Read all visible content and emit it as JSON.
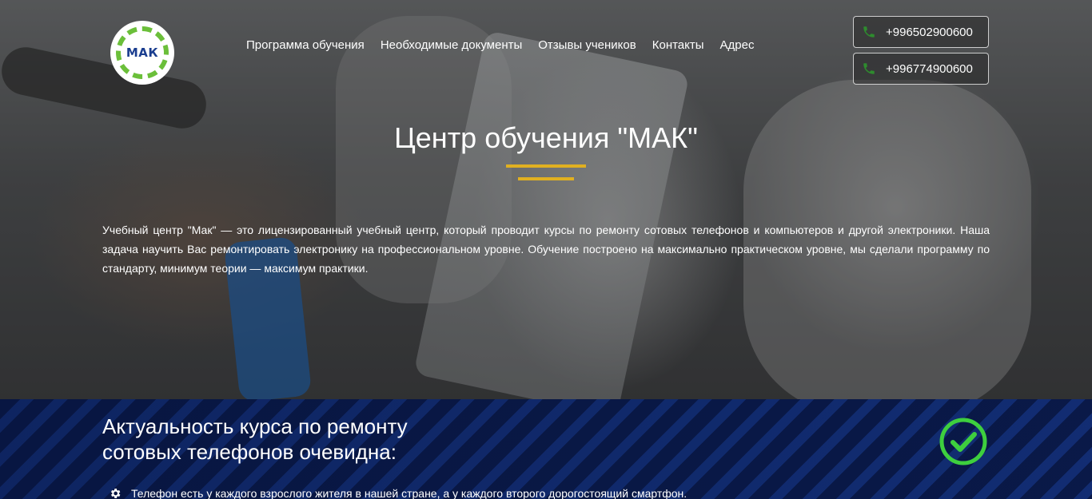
{
  "logo": {
    "text": "МАК"
  },
  "nav": {
    "items": [
      {
        "label": "Программа обучения"
      },
      {
        "label": "Необходимые документы"
      },
      {
        "label": "Отзывы учеников"
      },
      {
        "label": "Контакты"
      },
      {
        "label": "Адрес"
      }
    ]
  },
  "contacts": {
    "phone1": "+996502900600",
    "phone2": "+996774900600",
    "icon": "phone-icon",
    "icon_color": "#2e8b2e"
  },
  "hero": {
    "title": "Центр обучения \"МАК\"",
    "accent_color": "#e0b021",
    "description": "Учебный центр \"Мак\" — это лицензированный учебный центр, который проводит курсы по ремонту сотовых телефонов и компьютеров и другой электроники. Наша задача научить Вас ремонтировать электронику на профессиональном уровне. Обучение построено на максимально практическом уровне, мы сделали программу по стандарту, минимум теории — максимум практики."
  },
  "relevance": {
    "title_line1": "Актуальность курса по ремонту",
    "title_line2": "сотовых телефонов очевидна:",
    "check_icon": "check-circle-icon",
    "check_color": "#3ecf3e",
    "bullets": [
      {
        "icon": "gear-icon",
        "text": "Телефон есть у каждого взрослого жителя в нашей стране, а у каждого второго дорогостоящий смартфон."
      }
    ]
  }
}
